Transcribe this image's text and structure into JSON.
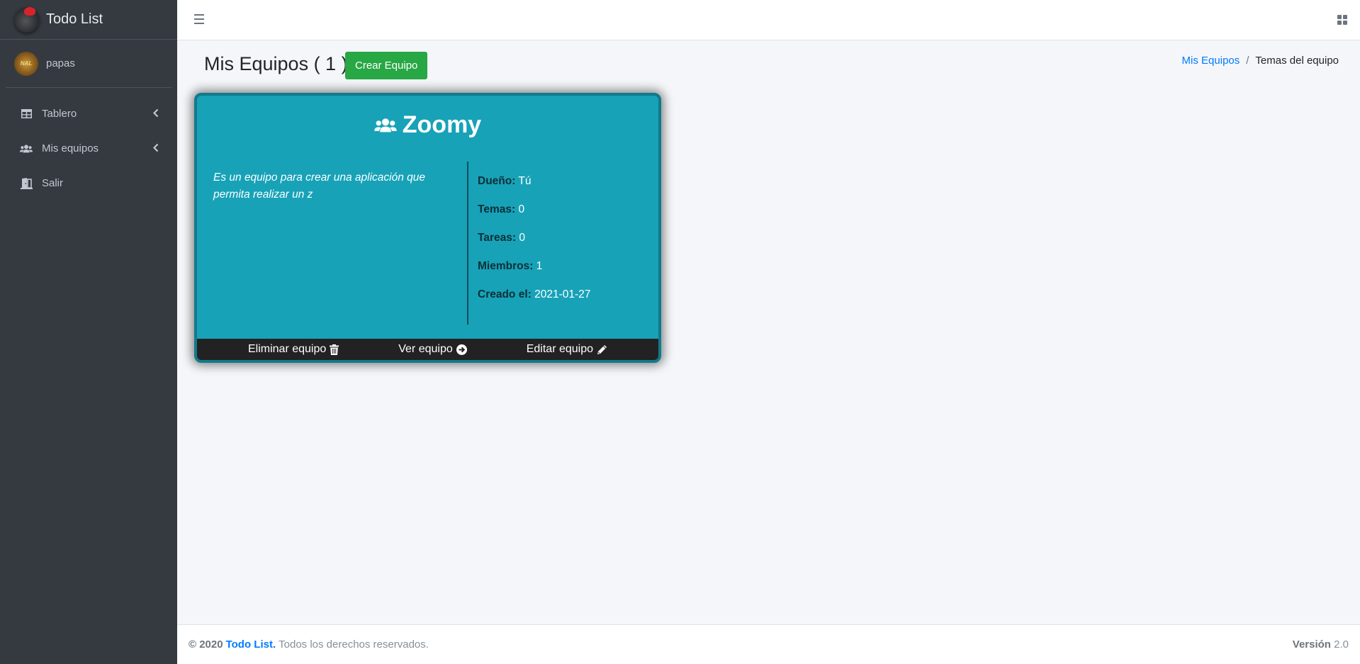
{
  "app": {
    "brand": "Todo List",
    "user_name": "papas",
    "avatar_text": "NAL"
  },
  "sidebar": {
    "items": [
      {
        "label": "Tablero",
        "icon": "table-icon"
      },
      {
        "label": "Mis equipos",
        "icon": "users-icon"
      },
      {
        "label": "Salir",
        "icon": "door-exit-icon"
      }
    ]
  },
  "header": {
    "title": "Mis Equipos ( 1 )",
    "create_button": "Crear Equipo",
    "breadcrumb": {
      "link": "Mis Equipos",
      "separator": "/",
      "active": "Temas del equipo"
    }
  },
  "teams": [
    {
      "name": "Zoomy",
      "description": "Es un equipo para crear una aplicación que permita realizar un z",
      "info": [
        {
          "label": "Dueño:",
          "value": "Tú"
        },
        {
          "label": "Temas:",
          "value": "0"
        },
        {
          "label": "Tareas:",
          "value": "0"
        },
        {
          "label": "Miembros:",
          "value": "1"
        },
        {
          "label": "Creado el:",
          "value": "2021-01-27"
        }
      ],
      "actions": {
        "delete": "Eliminar equipo",
        "view": "Ver equipo",
        "edit": "Editar equipo"
      }
    }
  ],
  "footer": {
    "copyright": "© 2020",
    "brand": "Todo List.",
    "rights": "Todos los derechos reservados.",
    "version_label": "Versión",
    "version_number": "2.0"
  },
  "colors": {
    "sidebar_bg": "#343a40",
    "card_bg": "#17a2b8",
    "card_border": "#117a8b",
    "success": "#28a745",
    "link": "#007bff"
  }
}
